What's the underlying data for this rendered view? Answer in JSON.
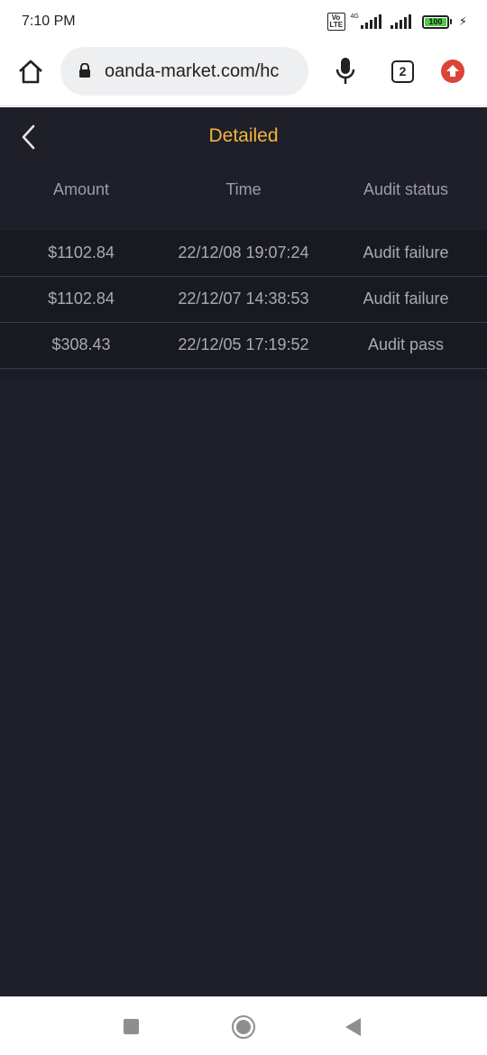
{
  "status_bar": {
    "time": "7:10 PM",
    "network": "4G",
    "volte": "Vo LTE",
    "battery": "100",
    "icons": [
      "volte-icon",
      "signal-icon",
      "battery-icon",
      "charging-icon"
    ]
  },
  "browser": {
    "url": "oanda-market.com/hc",
    "tab_count": "2",
    "icons": [
      "home-icon",
      "lock-icon",
      "mic-icon",
      "tabs-icon",
      "update-icon"
    ]
  },
  "page": {
    "title": "Detailed",
    "title_color": "#f3b43f",
    "background": "#1f1f29"
  },
  "table": {
    "headers": [
      "Amount",
      "Time",
      "Audit status"
    ],
    "rows": [
      {
        "amount": "$1102.84",
        "time": "22/12/08 19:07:24",
        "status": "Audit failure"
      },
      {
        "amount": "$1102.84",
        "time": "22/12/07 14:38:53",
        "status": "Audit failure"
      },
      {
        "amount": "$308.43",
        "time": "22/12/05 17:19:52",
        "status": "Audit pass"
      }
    ]
  },
  "nav_bar": {
    "icons": [
      "recents-icon",
      "home-circle-icon",
      "back-triangle-icon"
    ]
  }
}
